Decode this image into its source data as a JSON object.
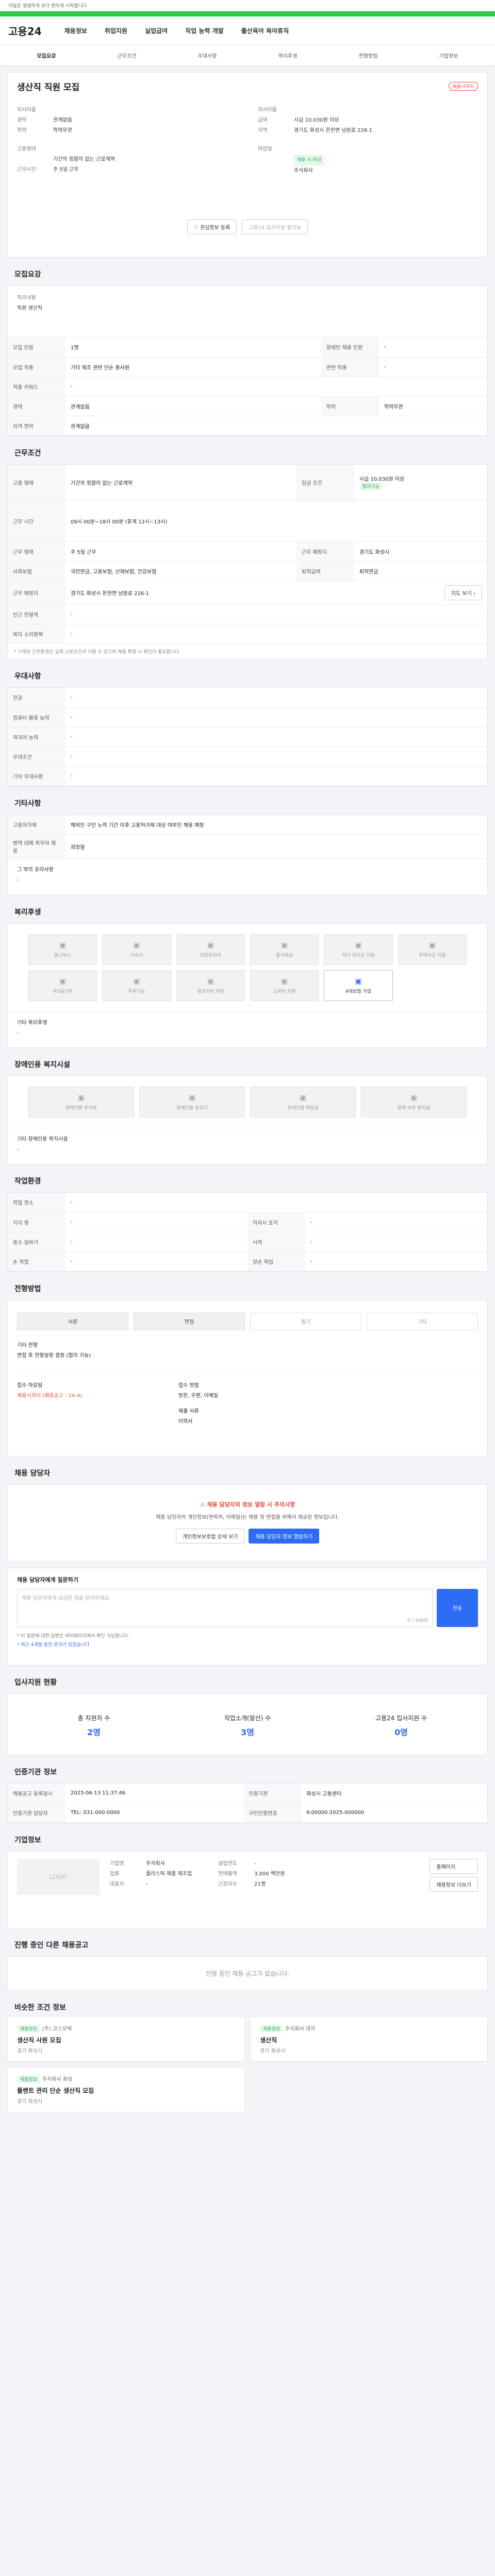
{
  "top": {
    "notice": "이달은 생생하게 보다 편하게 시작합니다",
    "logo": "고용24"
  },
  "gnb": [
    "채용정보",
    "취업지원",
    "실업급여",
    "직업 능력 개발",
    "출산육아 육아휴직"
  ],
  "subnav": [
    "모집요강",
    "근무조건",
    "우대사항",
    "복리후생",
    "전형방법",
    "기업정보"
  ],
  "job": {
    "title": "생산직 직원 모집",
    "status": "채용시까지",
    "company_label": "자사이름",
    "company": "주식회사",
    "industry_label": "고용형태",
    "industry": "기간의 정함이 없는 근로계약",
    "pay_label": "급여",
    "pay": "시급 10,030원 이상",
    "location_label": "지역",
    "location": "경기도 화성시 온천면 남원로 226-1",
    "career_label": "경력",
    "career": "관계없음",
    "edu_label": "학력",
    "edu": "학력무관",
    "time_label": "근무시간",
    "time": "주 5일 근무",
    "deadline_label": "마감일",
    "deadline": "채용 시 마감",
    "interest_btn": "관심정보 등록",
    "apply_btn": "고용24 입사지원 불가능"
  },
  "recruit": {
    "title": "모집요강",
    "duty_label": "직무내용",
    "duty": "직원 생산직",
    "rows": [
      {
        "k": "모집 인원",
        "v": "1명",
        "k2": "장애인 채용 인원",
        "v2": "-"
      },
      {
        "k": "모집 직종",
        "v": "기타 제조 관련 단순 종사원",
        "k2": "관련 직종",
        "v2": "-"
      },
      {
        "k": "직종 키워드",
        "v": "-",
        "k2": "",
        "v2": ""
      },
      {
        "k": "경력",
        "v": "관계없음",
        "k2": "학력",
        "v2": "학력무관"
      },
      {
        "k": "자격 면허",
        "v": "관계없음",
        "k2": "",
        "v2": ""
      }
    ]
  },
  "work": {
    "title": "근무조건",
    "rows": [
      {
        "k": "고용 형태",
        "v": "기간의 정함이 없는 근로계약",
        "k2": "임금 조건",
        "v2": "시급 10,030원 이상"
      },
      {
        "k": "근무 시간",
        "v": "09시 00분~18시 00분 (휴게 12시~13시)",
        "k2": "",
        "v2": ""
      },
      {
        "k": "근무 형태",
        "v": "주 5일 근무",
        "k2": "근무 예정지",
        "v2": "경기도 화성시"
      },
      {
        "k": "사회보험",
        "v": "국민연금, 고용보험, 산재보험, 건강보험",
        "k2": "퇴직급여",
        "v2": "퇴직연금"
      },
      {
        "k": "근무 예정지",
        "v": "경기도 화성시 온천면 남원로 226-1",
        "k2": "",
        "v2": ""
      },
      {
        "k": "인근 전철역",
        "v": "-",
        "k2": "",
        "v2": ""
      },
      {
        "k": "복지 소리항목",
        "v": "-",
        "k2": "",
        "v2": ""
      }
    ],
    "wage_tag": "협의가능",
    "note": "* 기재된 근무환경은 실제 근로조건과 다를 수 있으며 채용 확정 시 확인이 필요합니다."
  },
  "prefer": {
    "title": "우대사항",
    "rows": [
      [
        "전공",
        "-"
      ],
      [
        "컴퓨터 활용 능력",
        "-"
      ],
      [
        "외국어 능력",
        "-"
      ],
      [
        "우대조건",
        "-"
      ],
      [
        "기타 우대사항",
        "-"
      ]
    ]
  },
  "etc": {
    "title": "기타사항",
    "rows": [
      [
        "고용허가제",
        "해외인 구인 노력 기간 이후 고용허가제 대상 여부인 채용 예정"
      ],
      [
        "병역 대체 복무자 채용",
        "희망함"
      ]
    ],
    "other_label": "그 밖의 유의사항",
    "other": "-"
  },
  "welfare": {
    "title": "복리후생",
    "items": [
      {
        "icon": "▣",
        "label": "통근버스",
        "on": false
      },
      {
        "icon": "▣",
        "label": "기숙사",
        "on": false
      },
      {
        "icon": "▣",
        "label": "차량유지비",
        "on": false
      },
      {
        "icon": "▣",
        "label": "중식제공",
        "on": false
      },
      {
        "icon": "▣",
        "label": "자녀 학자금 지원",
        "on": false
      },
      {
        "icon": "▣",
        "label": "주택자금 지원",
        "on": false
      },
      {
        "icon": "▣",
        "label": "주5일근무",
        "on": false
      },
      {
        "icon": "▣",
        "label": "주차가능",
        "on": false
      },
      {
        "icon": "▣",
        "label": "경조사비 지원",
        "on": false
      },
      {
        "icon": "▣",
        "label": "교육비 지원",
        "on": false
      },
      {
        "icon": "▣",
        "label": "4대보험 가입",
        "on": true
      }
    ],
    "other_label": "기타 복리후생",
    "other": "-"
  },
  "disabled": {
    "title": "장애인용 복지시설",
    "items": [
      "장애인용 주차장",
      "장애인용 승강기",
      "장애인용 화장실",
      "장애 보조 편의설"
    ],
    "other_label": "기타 장애인용 복지시설",
    "other": "-"
  },
  "workenv": {
    "title": "작업환경",
    "rows": [
      {
        "k": "작업 장소",
        "v": "-",
        "k2": "",
        "v2": ""
      },
      {
        "k": "지지 형",
        "v": "-",
        "k2": "의자시 포각",
        "v2": "-"
      },
      {
        "k": "중소 일바기",
        "v": "-",
        "k2": "시력",
        "v2": "-"
      },
      {
        "k": "손 작업",
        "v": "-",
        "k2": "양손 작업",
        "v2": "-"
      }
    ]
  },
  "select": {
    "title": "전형방법",
    "methods": [
      {
        "label": "서류",
        "on": true
      },
      {
        "label": "면접",
        "on": true
      },
      {
        "label": "필기",
        "on": false
      },
      {
        "label": "기타",
        "on": false
      }
    ],
    "doc_label": "기타 전형",
    "doc": "면접 후 전형일정 결정 (협의 가능)",
    "period_label": "접수 마감일",
    "period": "채용시까지 (채용공고 : 24-4)",
    "method_label": "접수 방법",
    "method_val": "방문, 우편, 이메일",
    "docs_label": "제출 서류",
    "docs_val": "이력서"
  },
  "contact": {
    "title": "채용 담당자",
    "warning_title": "채용 담당자의 정보 열람 시 주의사항",
    "warning_body": "채용 담당자의 개인정보(연락처, 이메일)는 채용 및 면접을 위해서 제공된 정보입니다.",
    "btn1": "개인정보보호법 상세 보기",
    "btn2": "채용 담당자 정보 열람하기",
    "qa_title": "채용 담당자에게 질문하기",
    "qa_placeholder": "채용 담당자에게 궁금한 점을 문의하세요.",
    "qa_count": "0 / 300자",
    "qa_submit": "전송",
    "qa_note1": "* 이 질문에 대한 답변은 마이페이지에서 확인 가능합니다.",
    "qa_note2": "* 최근 4개월 동안 문의가 있었습니다"
  },
  "stats": {
    "title": "입사지원 현황",
    "boxes": [
      {
        "label": "총 지원자 수",
        "value": "2명"
      },
      {
        "label": "직업소개(알선) 수",
        "value": "3명"
      },
      {
        "label": "고용24 입사지원 수",
        "value": "0명"
      }
    ]
  },
  "agency": {
    "title": "인증기관 정보",
    "rows": [
      {
        "k": "채용공고 등록일시",
        "v": "2025-06-13 11:37:46",
        "k2": "인증기관",
        "v2": "화성시 고용센터"
      },
      {
        "k": "인증기관 담당자",
        "v": "TEL: 031-000-0000",
        "k2": "구인인증번호",
        "v2": "K-00000-2025-000000"
      }
    ]
  },
  "company": {
    "title": "기업정보",
    "logo_text": "LOGO",
    "rows": [
      {
        "k": "기업명",
        "v": "주식회사",
        "k2": "설립연도",
        "v2": "-"
      },
      {
        "k": "업종",
        "v": "플라스틱 제품 제조업",
        "k2": "연매출액",
        "v2": "3,000 백만원"
      },
      {
        "k": "대표자",
        "v": "-",
        "k2": "근로자수",
        "v2": "21명"
      }
    ],
    "home_btn": "홈페이지",
    "more_btn": "채용정보 더보기"
  },
  "others": {
    "title": "진행 중인 다른 채용공고",
    "empty": "진행 중인 채용 공고가 없습니다."
  },
  "similar": {
    "title": "비슷한 조건 정보",
    "cards": [
      {
        "tag": "채용정보",
        "company": "(주) 코스모텍",
        "title": "생산직 사원 모집",
        "loc": "경기 화성시"
      },
      {
        "tag": "채용정보",
        "company": "주식회사 대지",
        "title": "생산직",
        "loc": "경기 화성시"
      },
      {
        "tag": "채용정보",
        "company": "주식회사 화성",
        "title": "플랜트 관리 단순 생산직 모집",
        "loc": "경기 화성시"
      }
    ]
  }
}
